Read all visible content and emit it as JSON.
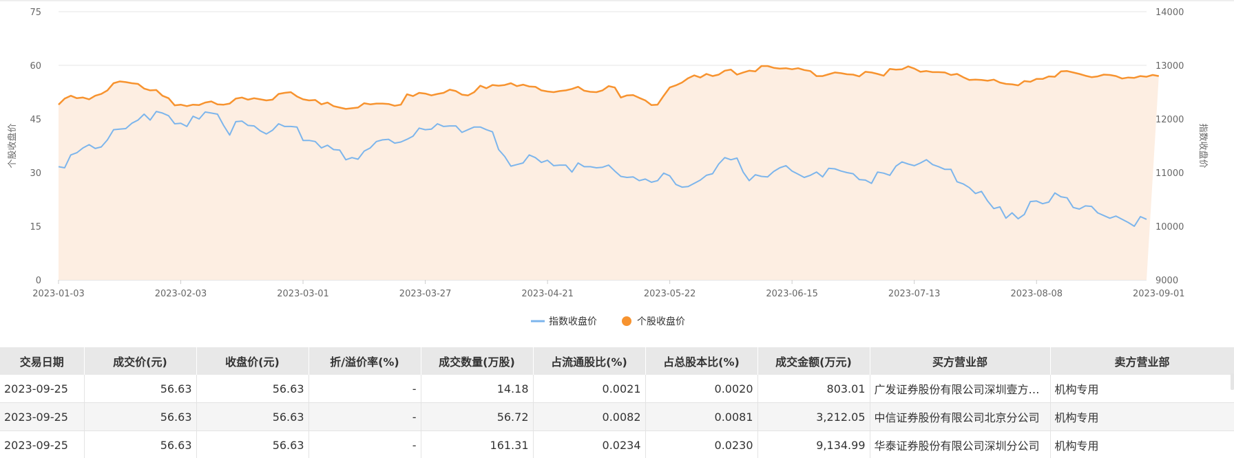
{
  "colors": {
    "index_line": "#7cb5ec",
    "stock_line": "#f7932f",
    "area_fill": "#fdeee2",
    "grid": "#e6e6e6",
    "header_bg": "#e8e8e8"
  },
  "chart_data": {
    "type": "line",
    "y_left_label": "个股收盘价",
    "y_right_label": "指数收盘价",
    "y_left_ticks": [
      "0",
      "15",
      "30",
      "45",
      "60",
      "75"
    ],
    "y_right_ticks": [
      "9000",
      "10000",
      "11000",
      "12000",
      "13000",
      "14000"
    ],
    "ylim_left": [
      0,
      75
    ],
    "ylim_right": [
      9000,
      14000
    ],
    "x_tick_labels": [
      "2023-01-03",
      "2023-02-03",
      "2023-03-01",
      "2023-03-27",
      "2023-04-21",
      "2023-05-22",
      "2023-06-15",
      "2023-07-13",
      "2023-08-08",
      "2023-09-01"
    ],
    "x_tick_positions": [
      0,
      20,
      40,
      60,
      80,
      100,
      120,
      140,
      160,
      180
    ],
    "grid": true,
    "legend": "bottom-center",
    "series": [
      {
        "name": "指数收盘价",
        "axis": "right",
        "values": [
          11110,
          11090,
          11330,
          11370,
          11460,
          11520,
          11450,
          11480,
          11610,
          11800,
          11810,
          11820,
          11920,
          11980,
          12090,
          11980,
          12140,
          12110,
          12060,
          11910,
          11920,
          11860,
          12050,
          12000,
          12130,
          12110,
          12090,
          11880,
          11700,
          11950,
          11960,
          11880,
          11870,
          11780,
          11720,
          11790,
          11910,
          11860,
          11860,
          11850,
          11600,
          11600,
          11580,
          11460,
          11510,
          11430,
          11420,
          11240,
          11280,
          11250,
          11400,
          11460,
          11580,
          11610,
          11620,
          11550,
          11570,
          11620,
          11680,
          11830,
          11800,
          11810,
          11910,
          11860,
          11870,
          11870,
          11750,
          11800,
          11850,
          11850,
          11800,
          11760,
          11430,
          11300,
          11120,
          11150,
          11180,
          11330,
          11280,
          11190,
          11230,
          11130,
          11140,
          11140,
          11010,
          11180,
          11110,
          11110,
          11090,
          11100,
          11140,
          11030,
          10930,
          10910,
          10920,
          10850,
          10880,
          10820,
          10850,
          10990,
          10940,
          10780,
          10730,
          10740,
          10800,
          10860,
          10950,
          10980,
          11160,
          11280,
          11240,
          11270,
          11010,
          10850,
          10960,
          10930,
          10920,
          11020,
          11090,
          11130,
          11030,
          10970,
          10910,
          10950,
          11010,
          10920,
          11080,
          11070,
          11030,
          11000,
          10980,
          10870,
          10860,
          10800,
          11010,
          10990,
          10950,
          11120,
          11200,
          11160,
          11130,
          11180,
          11240,
          11150,
          11110,
          11060,
          11060,
          10830,
          10790,
          10720,
          10610,
          10650,
          10470,
          10330,
          10360,
          10150,
          10250,
          10140,
          10220,
          10460,
          10470,
          10420,
          10450,
          10620,
          10550,
          10530,
          10350,
          10320,
          10380,
          10370,
          10250,
          10200,
          10150,
          10190,
          10130,
          10070,
          10000,
          10180,
          10130
        ]
      },
      {
        "name": "个股收盘价",
        "axis": "left",
        "values": [
          49.0,
          50.7,
          51.5,
          50.8,
          51.0,
          50.5,
          51.5,
          52.0,
          53.0,
          55.0,
          55.5,
          55.3,
          55.0,
          54.8,
          53.5,
          53.0,
          53.1,
          51.5,
          50.8,
          48.8,
          49.0,
          48.6,
          49.0,
          48.9,
          49.6,
          49.9,
          49.1,
          49.0,
          49.3,
          50.7,
          51.0,
          50.4,
          50.8,
          50.5,
          50.2,
          50.4,
          52.0,
          52.3,
          52.5,
          51.3,
          50.5,
          50.2,
          50.3,
          49.1,
          49.6,
          48.6,
          48.2,
          47.8,
          48.0,
          48.2,
          49.4,
          49.1,
          49.3,
          49.3,
          49.2,
          48.7,
          49.0,
          51.9,
          51.4,
          52.3,
          52.1,
          51.6,
          52.0,
          52.3,
          53.2,
          52.8,
          51.8,
          51.6,
          52.5,
          54.3,
          53.6,
          54.5,
          54.3,
          54.5,
          55.0,
          54.2,
          54.6,
          54.1,
          54.0,
          53.0,
          52.7,
          52.5,
          52.8,
          53.0,
          53.4,
          54.0,
          52.9,
          52.6,
          52.5,
          53.0,
          54.2,
          53.8,
          51.0,
          51.6,
          51.7,
          50.9,
          50.2,
          48.9,
          49.0,
          51.5,
          53.8,
          54.4,
          55.2,
          56.4,
          57.2,
          56.6,
          57.6,
          57.0,
          57.4,
          58.5,
          58.8,
          57.4,
          58.0,
          58.5,
          58.3,
          59.8,
          59.8,
          59.3,
          59.1,
          59.2,
          58.9,
          59.2,
          58.7,
          58.4,
          57.0,
          57.0,
          57.5,
          58.0,
          57.8,
          57.5,
          57.4,
          56.9,
          58.2,
          58.0,
          57.6,
          57.1,
          59.0,
          58.8,
          58.9,
          59.7,
          59.1,
          58.2,
          58.4,
          58.1,
          58.1,
          58.0,
          57.3,
          57.6,
          56.7,
          55.9,
          56.0,
          55.9,
          55.7,
          56.0,
          55.2,
          54.8,
          54.7,
          54.4,
          55.6,
          55.4,
          56.2,
          56.2,
          56.9,
          56.8,
          58.3,
          58.4,
          58.0,
          57.6,
          57.1,
          56.7,
          56.9,
          57.4,
          57.3,
          57.0,
          56.3,
          56.6,
          56.5,
          57.0,
          56.8,
          57.3,
          57.0
        ]
      }
    ]
  },
  "table": {
    "headers": [
      "交易日期",
      "成交价(元)",
      "收盘价(元)",
      "折/溢价率(%)",
      "成交数量(万股)",
      "占流通股比(%)",
      "占总股本比(%)",
      "成交金额(万元)",
      "买方营业部",
      "卖方营业部"
    ],
    "rows": [
      [
        "2023-09-25",
        "56.63",
        "56.63",
        "-",
        "14.18",
        "0.0021",
        "0.0020",
        "803.01",
        "广发证券股份有限公司深圳壹方中心证券营业部",
        "机构专用"
      ],
      [
        "2023-09-25",
        "56.63",
        "56.63",
        "-",
        "56.72",
        "0.0082",
        "0.0081",
        "3,212.05",
        "中信证券股份有限公司北京分公司",
        "机构专用"
      ],
      [
        "2023-09-25",
        "56.63",
        "56.63",
        "-",
        "161.31",
        "0.0234",
        "0.0230",
        "9,134.99",
        "华泰证券股份有限公司深圳分公司",
        "机构专用"
      ]
    ]
  }
}
